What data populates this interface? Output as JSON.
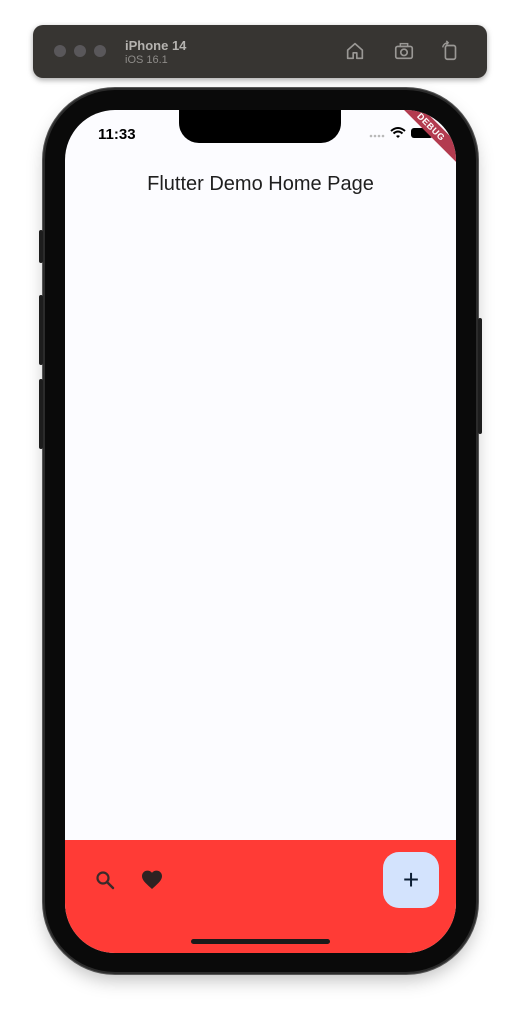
{
  "simulator": {
    "device_name": "iPhone 14",
    "os_version": "iOS 16.1",
    "tools": [
      "home-icon",
      "screenshot-icon",
      "rotate-icon"
    ]
  },
  "status_bar": {
    "time": "11:33"
  },
  "debug_banner": "DEBUG",
  "app_bar": {
    "title": "Flutter Demo Home Page"
  },
  "bottom_bar": {
    "background": "#ff3b36",
    "items": [
      "search-icon",
      "heart-icon"
    ],
    "fab_icon": "+",
    "fab_background": "#d3e3fd"
  }
}
